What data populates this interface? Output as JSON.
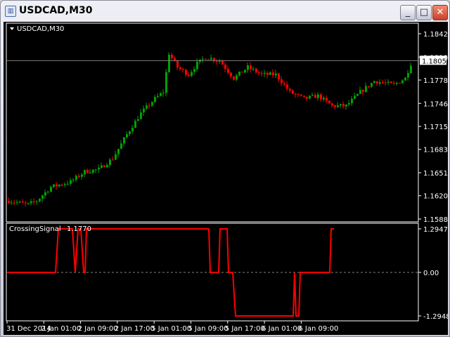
{
  "window": {
    "title": "USDCAD,M30",
    "icon": "chart-window-icon",
    "minimize": "_",
    "maximize": "□",
    "close": "✕"
  },
  "main_chart": {
    "label": "USDCAD,M30",
    "current_price": "1.18051",
    "price_axis": [
      "1.18420",
      "1.18100",
      "1.17785",
      "1.17465",
      "1.17150",
      "1.16835",
      "1.16515",
      "1.16200",
      "1.15880"
    ],
    "colors": {
      "bull": "#00a000",
      "bear": "#ff0000",
      "background": "#000000"
    }
  },
  "indicator": {
    "label": "CrossingSignal",
    "value": "1.1770",
    "axis": [
      "1.2947",
      "0.00",
      "-1.2948"
    ],
    "color": "#ff0000"
  },
  "time_axis": [
    "31 Dec 2014",
    "2 Jan 01:00",
    "2 Jan 09:00",
    "2 Jan 17:00",
    "5 Jan 01:00",
    "5 Jan 09:00",
    "5 Jan 17:00",
    "6 Jan 01:00",
    "6 Jan 09:00"
  ],
  "chart_data": {
    "type": "candlestick",
    "symbol": "USDCAD",
    "timeframe": "M30",
    "ylim": [
      1.1588,
      1.1842
    ],
    "price_path": [
      [
        0,
        1.1613
      ],
      [
        7,
        1.1608
      ],
      [
        10,
        1.1613
      ],
      [
        15,
        1.1632
      ],
      [
        22,
        1.1639
      ],
      [
        27,
        1.1653
      ],
      [
        32,
        1.1656
      ],
      [
        37,
        1.1671
      ],
      [
        42,
        1.1704
      ],
      [
        47,
        1.1733
      ],
      [
        52,
        1.1753
      ],
      [
        55,
        1.1762
      ],
      [
        57,
        1.1815
      ],
      [
        60,
        1.1796
      ],
      [
        64,
        1.1786
      ],
      [
        67,
        1.1801
      ],
      [
        70,
        1.181
      ],
      [
        75,
        1.1805
      ],
      [
        80,
        1.1781
      ],
      [
        85,
        1.1796
      ],
      [
        90,
        1.1786
      ],
      [
        95,
        1.1786
      ],
      [
        100,
        1.1762
      ],
      [
        105,
        1.1753
      ],
      [
        110,
        1.1757
      ],
      [
        115,
        1.1743
      ],
      [
        120,
        1.1743
      ],
      [
        125,
        1.1762
      ],
      [
        130,
        1.1777
      ],
      [
        137,
        1.1772
      ],
      [
        141,
        1.1781
      ],
      [
        143,
        1.1801
      ]
    ],
    "indicator_series": [
      [
        0,
        0
      ],
      [
        17,
        0
      ],
      [
        18,
        1.2947
      ],
      [
        23,
        1.2947
      ],
      [
        24,
        0
      ],
      [
        25,
        1.2947
      ],
      [
        26,
        1.2947
      ],
      [
        27,
        0
      ],
      [
        27.5,
        0
      ],
      [
        28,
        1.2947
      ],
      [
        71.5,
        1.2947
      ],
      [
        72,
        0
      ],
      [
        75,
        0
      ],
      [
        75.5,
        1.2947
      ],
      [
        78,
        1.2947
      ],
      [
        78.5,
        0
      ],
      [
        80,
        0
      ],
      [
        81,
        -1.2948
      ],
      [
        101.5,
        -1.2948
      ],
      [
        102,
        0
      ],
      [
        102.5,
        -1.2948
      ],
      [
        103.5,
        -1.2948
      ],
      [
        104,
        0
      ],
      [
        114.5,
        0
      ],
      [
        115,
        1.2947
      ],
      [
        116,
        1.2947
      ]
    ],
    "indicator_ylim": [
      -1.2948,
      1.2947
    ]
  }
}
